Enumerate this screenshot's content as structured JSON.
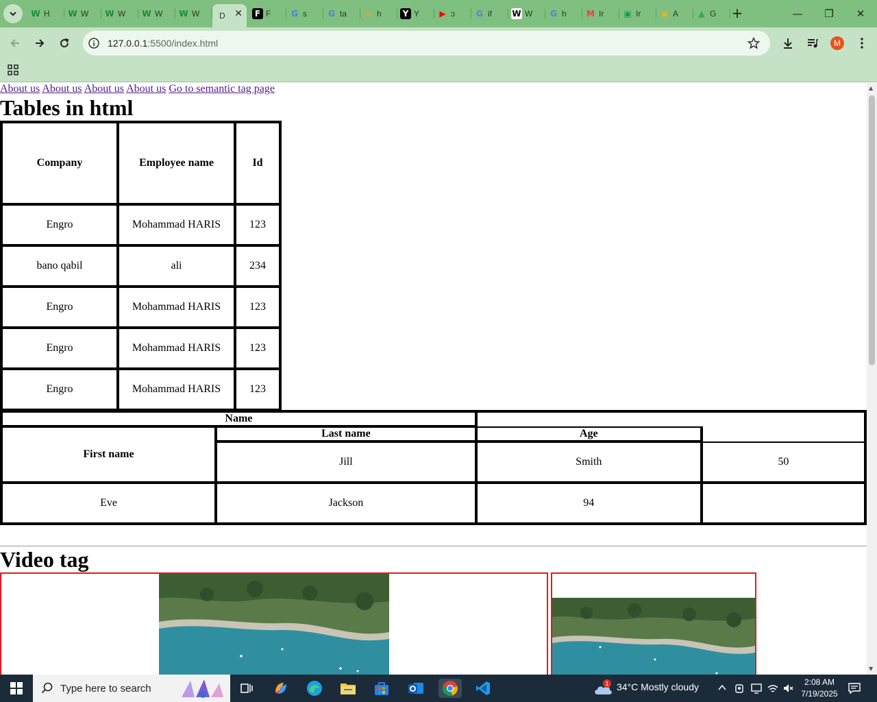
{
  "browser": {
    "tabs": [
      {
        "icon": "W",
        "title": "H",
        "color": "#1b8a3c"
      },
      {
        "icon": "W",
        "title": "W",
        "color": "#1b8a3c"
      },
      {
        "icon": "W",
        "title": "W",
        "color": "#1b8a3c"
      },
      {
        "icon": "W",
        "title": "W",
        "color": "#1b8a3c"
      },
      {
        "icon": "W",
        "title": "W",
        "color": "#1b8a3c"
      },
      {
        "icon": "",
        "title": "D",
        "color": "#000000",
        "active": true
      },
      {
        "icon": "F",
        "title": "F",
        "color": "#000000"
      },
      {
        "icon": "G",
        "title": "s",
        "color": "#4285f4"
      },
      {
        "icon": "G",
        "title": "ta",
        "color": "#4285f4"
      },
      {
        "icon": "h",
        "title": "h",
        "color": "#e2a33b"
      },
      {
        "icon": "Y",
        "title": "Y",
        "color": "#000000"
      },
      {
        "icon": "▶",
        "title": "ɔ",
        "color": "#ff0000"
      },
      {
        "icon": "G",
        "title": "if",
        "color": "#4285f4"
      },
      {
        "icon": "W",
        "title": "W",
        "color": "#000000"
      },
      {
        "icon": "G",
        "title": "h",
        "color": "#4285f4"
      },
      {
        "icon": "M",
        "title": "Ir",
        "color": "#ea4335"
      },
      {
        "icon": "▣",
        "title": "Ir",
        "color": "#0f9d58"
      },
      {
        "icon": "▣",
        "title": "A",
        "color": "#f4b400"
      },
      {
        "icon": "▲",
        "title": "G",
        "color": "#34a853"
      }
    ],
    "url_host": "127.0.0.1",
    "url_path": ":5500/index.html",
    "profile_initial": "M"
  },
  "page": {
    "nav_links": [
      "About us",
      "About us",
      "About us",
      "About us",
      "Go to semantic tag page"
    ],
    "tables_heading": "Tables in html",
    "table1": {
      "headers": [
        "Company",
        "Employee name",
        "Id"
      ],
      "rows": [
        [
          "Engro",
          "Mohammad HARIS",
          "123"
        ],
        [
          "bano qabil",
          "ali",
          "234"
        ],
        [
          "Engro",
          "Mohammad HARIS",
          "123"
        ],
        [
          "Engro",
          "Mohammad HARIS",
          "123"
        ],
        [
          "Engro",
          "Mohammad HARIS",
          "123"
        ]
      ]
    },
    "table2": {
      "name_header": "Name",
      "first_name_header": "First name",
      "last_name_header": "Last name",
      "age_header": "Age",
      "row1": [
        "Jill",
        "Smith",
        "50"
      ],
      "row2": [
        "Eve",
        "Jackson",
        "94"
      ]
    },
    "video_heading": "Video tag"
  },
  "taskbar": {
    "search_placeholder": "Type here to search",
    "weather": "34°C  Mostly cloudy",
    "weather_badge": "1",
    "time": "2:08 AM",
    "date": "7/19/2025"
  },
  "colors": {
    "chrome_tab_strip": "#7fbf7f",
    "chrome_toolbar": "#c6e2c6",
    "link_visited": "#551a8b",
    "video_border": "#e31b1b",
    "taskbar": "#1c2b3a"
  }
}
